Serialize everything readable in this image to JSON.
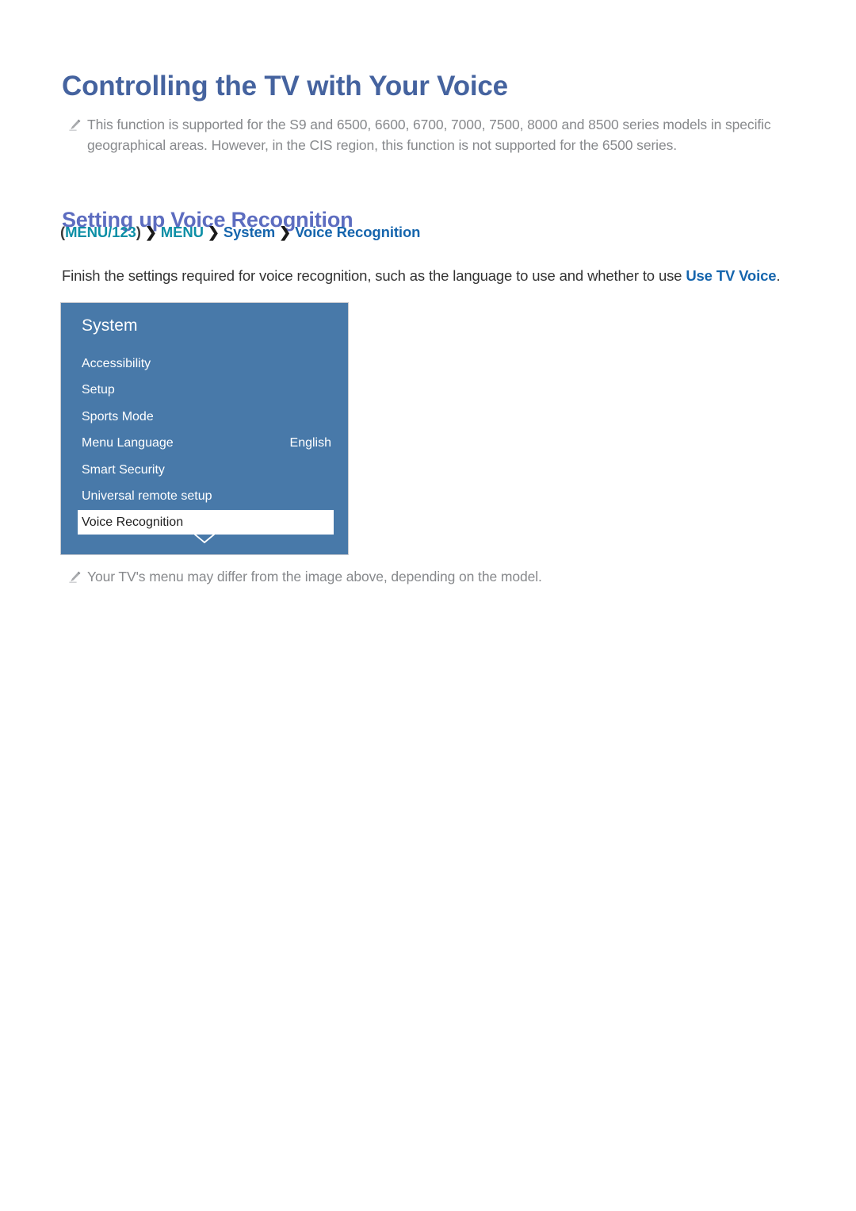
{
  "document": {
    "title": "Controlling the TV with Your Voice"
  },
  "notes": {
    "top": "This function is supported for the S9 and 6500, 6600, 6700, 7000, 7500, 8000 and 8500 series models in specific geographical areas. However, in the CIS region, this function is not supported for the 6500 series.",
    "bottom": "Your TV's menu may differ from the image above, depending on the model.",
    "icon": "pencil-icon"
  },
  "section": {
    "heading": "Setting up Voice Recognition",
    "breadcrumb": {
      "open_paren": "(",
      "close_paren": ")",
      "items": [
        {
          "label": "MENU/123",
          "color": "teal"
        },
        {
          "label": "MENU",
          "color": "teal"
        },
        {
          "label": "System",
          "color": "blue"
        },
        {
          "label": "Voice Recognition",
          "color": "blue"
        }
      ],
      "separator": "❯"
    },
    "paragraph": {
      "before": "Finish the settings required for voice recognition, such as the language to use and whether to use ",
      "highlight": "Use TV Voice",
      "after": "."
    }
  },
  "tv_menu": {
    "title": "System",
    "items": [
      {
        "label": "Accessibility",
        "value": "",
        "selected": false
      },
      {
        "label": "Setup",
        "value": "",
        "selected": false
      },
      {
        "label": "Sports Mode",
        "value": "",
        "selected": false
      },
      {
        "label": "Menu Language",
        "value": "English",
        "selected": false
      },
      {
        "label": "Smart Security",
        "value": "",
        "selected": false
      },
      {
        "label": "Universal remote setup",
        "value": "",
        "selected": false
      },
      {
        "label": "Voice Recognition",
        "value": "",
        "selected": true
      }
    ],
    "scroll_icon": "chevron-down-icon"
  },
  "colors": {
    "page_title": "#45639F",
    "section_heading": "#5D6DC0",
    "breadcrumb_teal": "#0C8FA6",
    "breadcrumb_blue": "#1565AD",
    "link_highlight": "#1565AD",
    "note_text": "#87898C",
    "body_text": "#333333",
    "panel_background": "#4879A9",
    "panel_text": "#FFFFFF",
    "selected_row_background": "#FFFFFF",
    "selected_row_text": "#202020",
    "page_background": "#FFFFFF"
  }
}
